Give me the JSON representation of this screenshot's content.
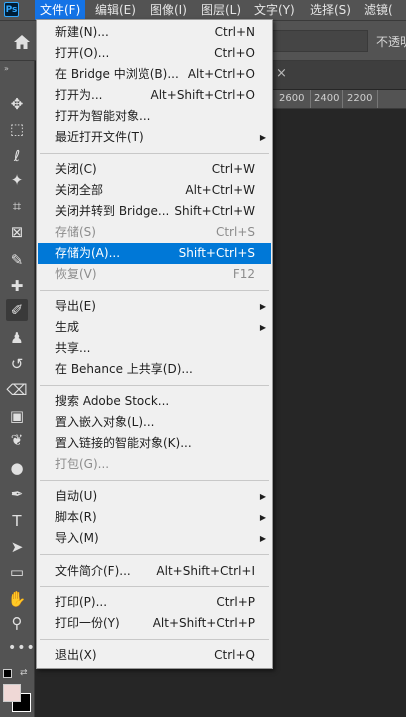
{
  "app": {
    "logo": "Ps"
  },
  "menubar": {
    "items": [
      {
        "label": "文件(F)",
        "active": true
      },
      {
        "label": "编辑(E)"
      },
      {
        "label": "图像(I)"
      },
      {
        "label": "图层(L)"
      },
      {
        "label": "文字(Y)"
      },
      {
        "label": "选择(S)"
      },
      {
        "label": "滤镜("
      }
    ]
  },
  "options_bar": {
    "opacity_label": "不透明"
  },
  "ruler": {
    "ticks": [
      "2600",
      "2400",
      "2200"
    ]
  },
  "file_menu": {
    "items": [
      {
        "label": "新建(N)...",
        "shortcut": "Ctrl+N"
      },
      {
        "label": "打开(O)...",
        "shortcut": "Ctrl+O"
      },
      {
        "label": "在 Bridge 中浏览(B)...",
        "shortcut": "Alt+Ctrl+O"
      },
      {
        "label": "打开为...",
        "shortcut": "Alt+Shift+Ctrl+O"
      },
      {
        "label": "打开为智能对象...",
        "shortcut": ""
      },
      {
        "label": "最近打开文件(T)",
        "shortcut": "",
        "submenu": true
      },
      {
        "label": "关闭(C)",
        "shortcut": "Ctrl+W"
      },
      {
        "label": "关闭全部",
        "shortcut": "Alt+Ctrl+W"
      },
      {
        "label": "关闭并转到 Bridge...",
        "shortcut": "Shift+Ctrl+W"
      },
      {
        "label": "存储(S)",
        "shortcut": "Ctrl+S",
        "disabled": true
      },
      {
        "label": "存储为(A)...",
        "shortcut": "Shift+Ctrl+S",
        "highlighted": true
      },
      {
        "label": "恢复(V)",
        "shortcut": "F12",
        "disabled": true
      },
      {
        "label": "导出(E)",
        "shortcut": "",
        "submenu": true
      },
      {
        "label": "生成",
        "shortcut": "",
        "submenu": true
      },
      {
        "label": "共享...",
        "shortcut": ""
      },
      {
        "label": "在 Behance 上共享(D)...",
        "shortcut": ""
      },
      {
        "label": "搜索 Adobe Stock...",
        "shortcut": ""
      },
      {
        "label": "置入嵌入对象(L)...",
        "shortcut": ""
      },
      {
        "label": "置入链接的智能对象(K)...",
        "shortcut": ""
      },
      {
        "label": "打包(G)...",
        "shortcut": "",
        "disabled": true
      },
      {
        "label": "自动(U)",
        "shortcut": "",
        "submenu": true
      },
      {
        "label": "脚本(R)",
        "shortcut": "",
        "submenu": true
      },
      {
        "label": "导入(M)",
        "shortcut": "",
        "submenu": true
      },
      {
        "label": "文件简介(F)...",
        "shortcut": "Alt+Shift+Ctrl+I"
      },
      {
        "label": "打印(P)...",
        "shortcut": "Ctrl+P"
      },
      {
        "label": "打印一份(Y)",
        "shortcut": "Alt+Shift+Ctrl+P"
      },
      {
        "label": "退出(X)",
        "shortcut": "Ctrl+Q"
      }
    ],
    "submenu_arrow": "▶"
  },
  "toolbar": {
    "collapse_glyph": "»",
    "more_glyph": "•••",
    "tools": [
      {
        "name": "move-tool-icon",
        "glyph": "✥"
      },
      {
        "name": "marquee-tool-icon",
        "glyph": "⬚"
      },
      {
        "name": "lasso-tool-icon",
        "glyph": "ℓ"
      },
      {
        "name": "magic-wand-tool-icon",
        "glyph": "✦"
      },
      {
        "name": "crop-tool-icon",
        "glyph": "⌗"
      },
      {
        "name": "frame-tool-icon",
        "glyph": "⊠"
      },
      {
        "name": "eyedropper-tool-icon",
        "glyph": "✎"
      },
      {
        "name": "healing-brush-tool-icon",
        "glyph": "✚"
      },
      {
        "name": "brush-tool-icon",
        "glyph": "✐",
        "active": true
      },
      {
        "name": "stamp-tool-icon",
        "glyph": "♟"
      },
      {
        "name": "history-brush-tool-icon",
        "glyph": "↺"
      },
      {
        "name": "eraser-tool-icon",
        "glyph": "⌫"
      },
      {
        "name": "gradient-tool-icon",
        "glyph": "▣"
      },
      {
        "name": "blur-tool-icon",
        "glyph": "❦"
      },
      {
        "name": "dodge-tool-icon",
        "glyph": "●"
      },
      {
        "name": "pen-tool-icon",
        "glyph": "✒"
      },
      {
        "name": "type-tool-icon",
        "glyph": "T"
      },
      {
        "name": "path-selection-tool-icon",
        "glyph": "➤"
      },
      {
        "name": "rectangle-tool-icon",
        "glyph": "▭"
      },
      {
        "name": "hand-tool-icon",
        "glyph": "✋"
      },
      {
        "name": "zoom-tool-icon",
        "glyph": "⚲"
      }
    ]
  },
  "colors": {
    "accent": "#0078d7",
    "foreground_swatch": "#efd8d6",
    "background_swatch": "#000000"
  }
}
